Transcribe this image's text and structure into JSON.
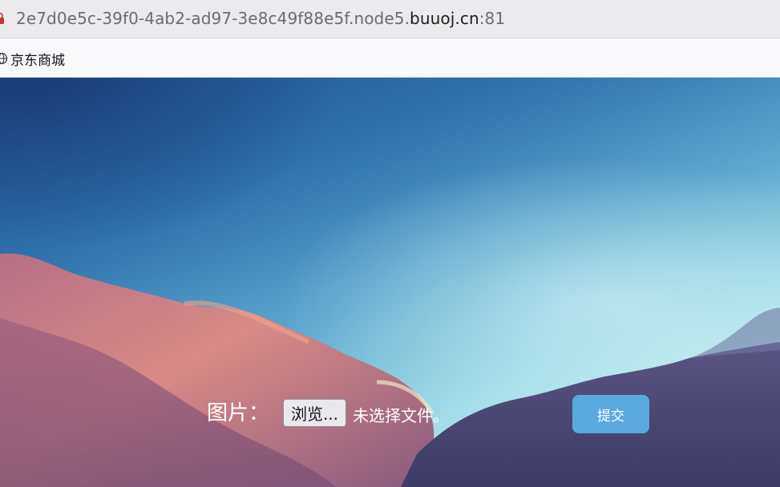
{
  "browser": {
    "url_prefix": "2e7d0e5c-39f0-4ab2-ad97-3e8c49f88e5f.node5.",
    "url_host": "buuoj.cn",
    "url_port": ":81",
    "lock_icon": "lock-icon",
    "bookmarks": [
      {
        "label": "京东商城",
        "icon": "globe-icon"
      }
    ]
  },
  "form": {
    "field_label": "图片：",
    "browse_label": "浏览...",
    "file_status": "未选择文件。",
    "submit_label": "提交"
  },
  "colors": {
    "submit_button": "#5aa9de",
    "sky_top": "#1f4f8f",
    "sky_light": "#cdeef0",
    "cloud_pink": "#c47a86",
    "cloud_purple": "#4e4876"
  }
}
